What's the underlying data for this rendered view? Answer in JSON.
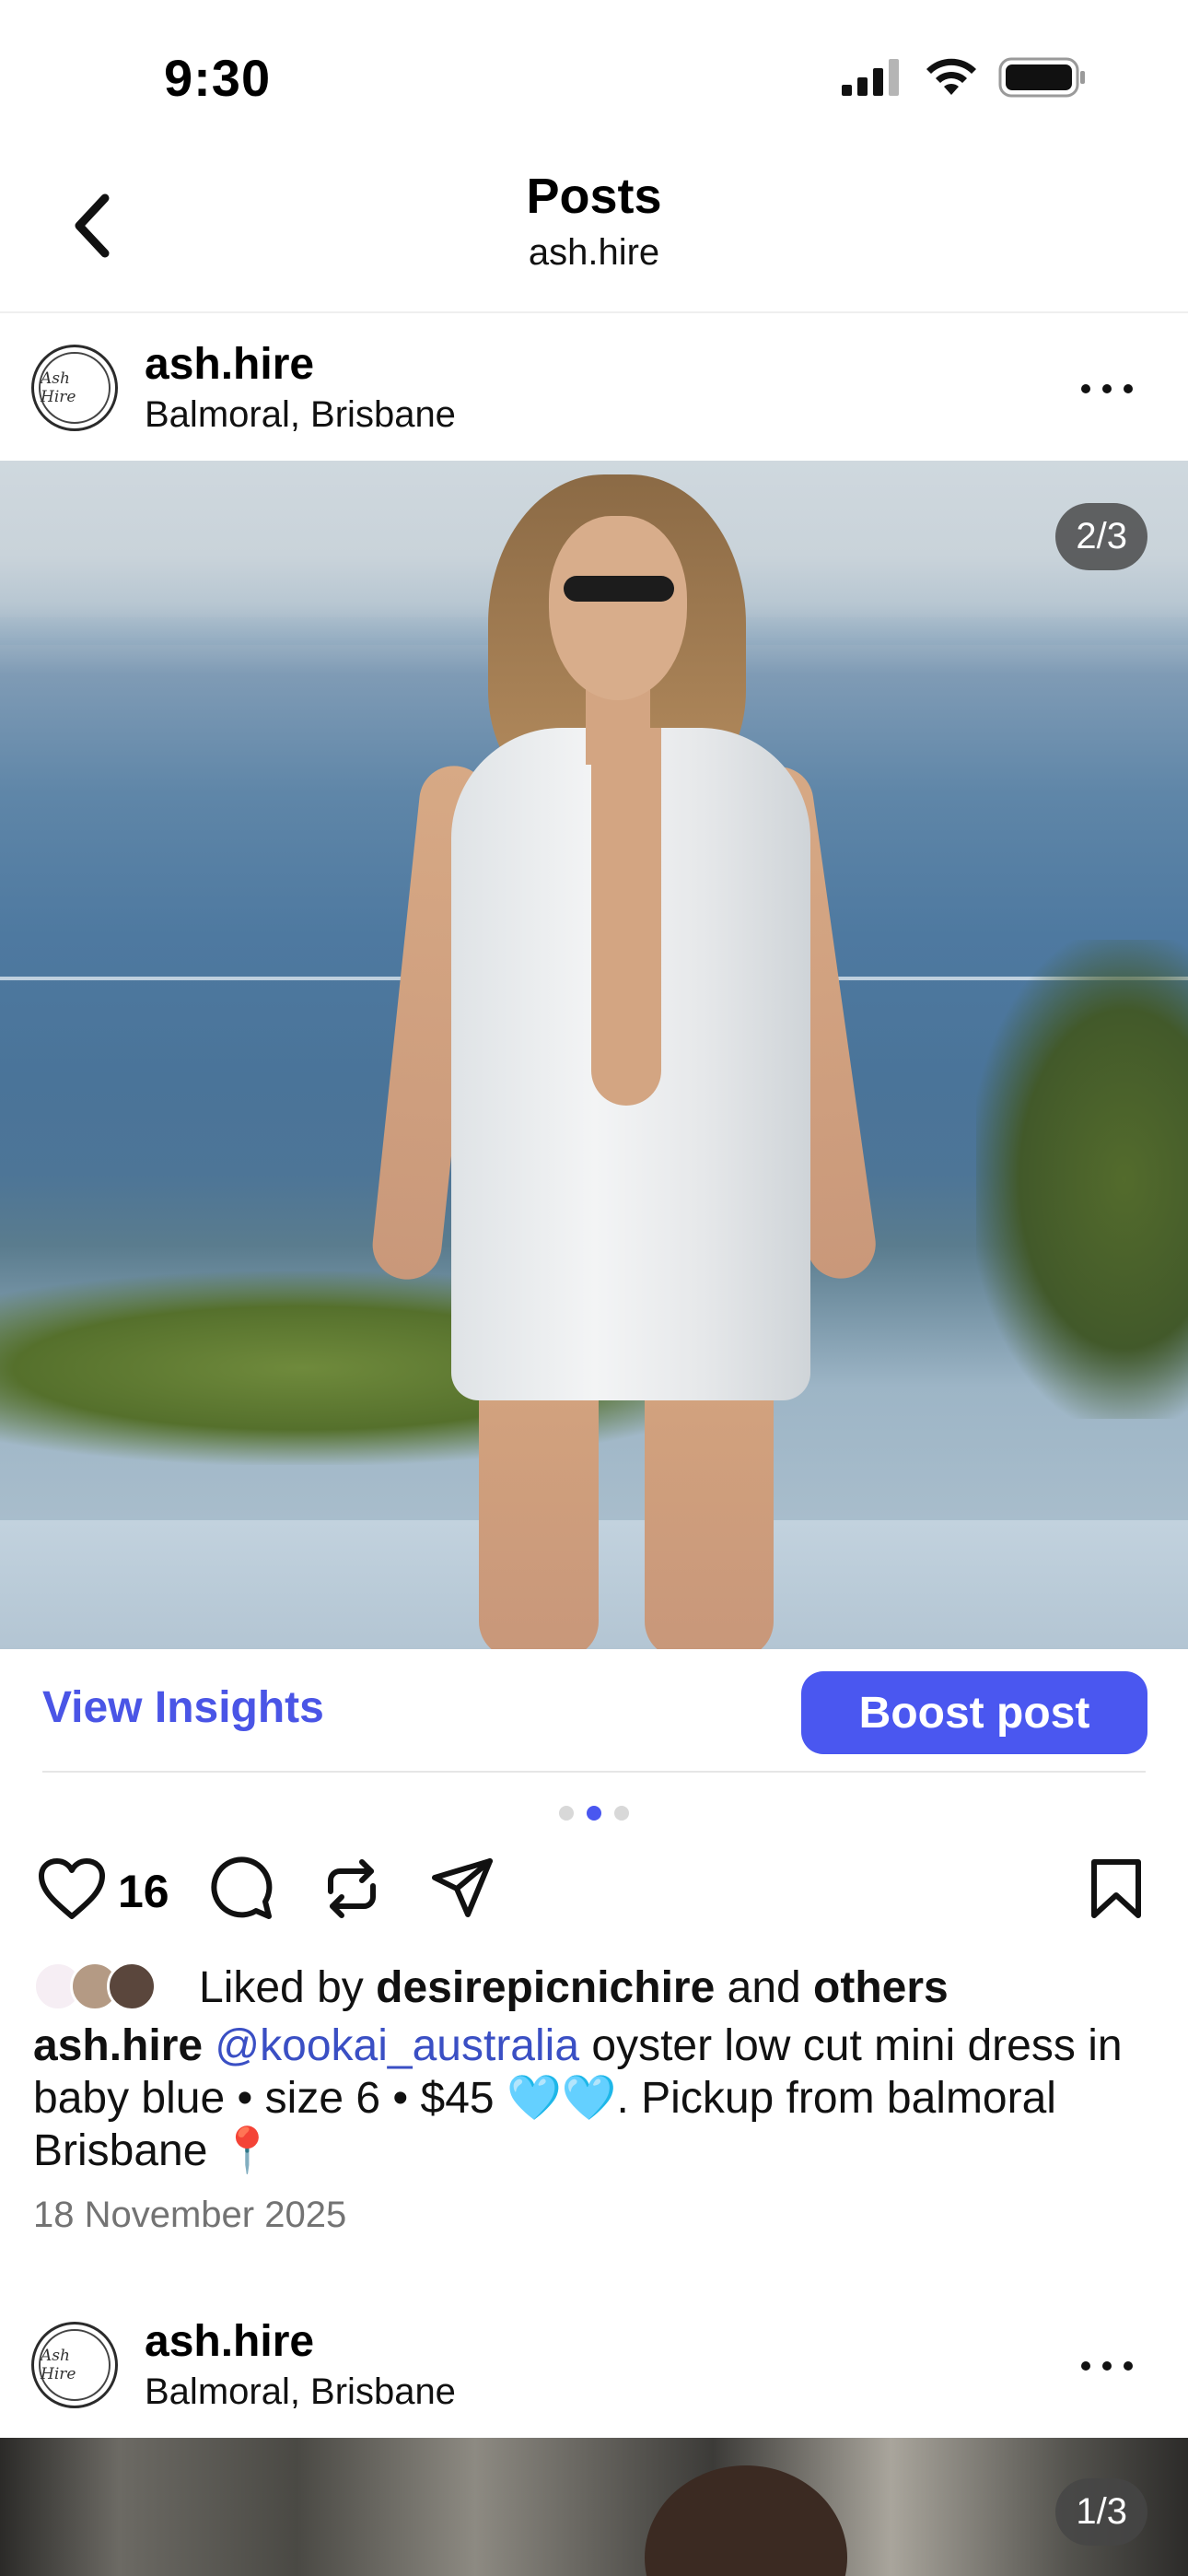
{
  "status_bar": {
    "time": "9:30",
    "icons": [
      "cellular-signal-icon",
      "wifi-icon",
      "battery-icon"
    ]
  },
  "nav": {
    "title": "Posts",
    "subtitle": "ash.hire",
    "back_icon": "chevron-left-icon"
  },
  "posts": [
    {
      "avatar_text": "Ash Hire",
      "username": "ash.hire",
      "location": "Balmoral, Brisbane",
      "counter": "2/3",
      "insights_label": "View Insights",
      "boost_label": "Boost post",
      "carousel": {
        "count": 3,
        "active_index": 1
      },
      "likes": "16",
      "liked_prefix": "Liked by ",
      "liked_user": "desirepicnichire",
      "liked_and": " and ",
      "liked_others": "others",
      "caption_user": "ash.hire",
      "caption_mention": "@kookai_australia",
      "caption_text": " oyster low cut mini dress in baby blue • size 6 • $45 🩵🩵. Pickup from balmoral Brisbane 📍",
      "date": "18 November 2025"
    },
    {
      "avatar_text": "Ash Hire",
      "username": "ash.hire",
      "location": "Balmoral, Brisbane",
      "counter": "1/3"
    }
  ],
  "colors": {
    "accent": "#4a57f0",
    "link": "#4a55e6",
    "mention": "#3a4fc4",
    "muted": "#737373"
  }
}
